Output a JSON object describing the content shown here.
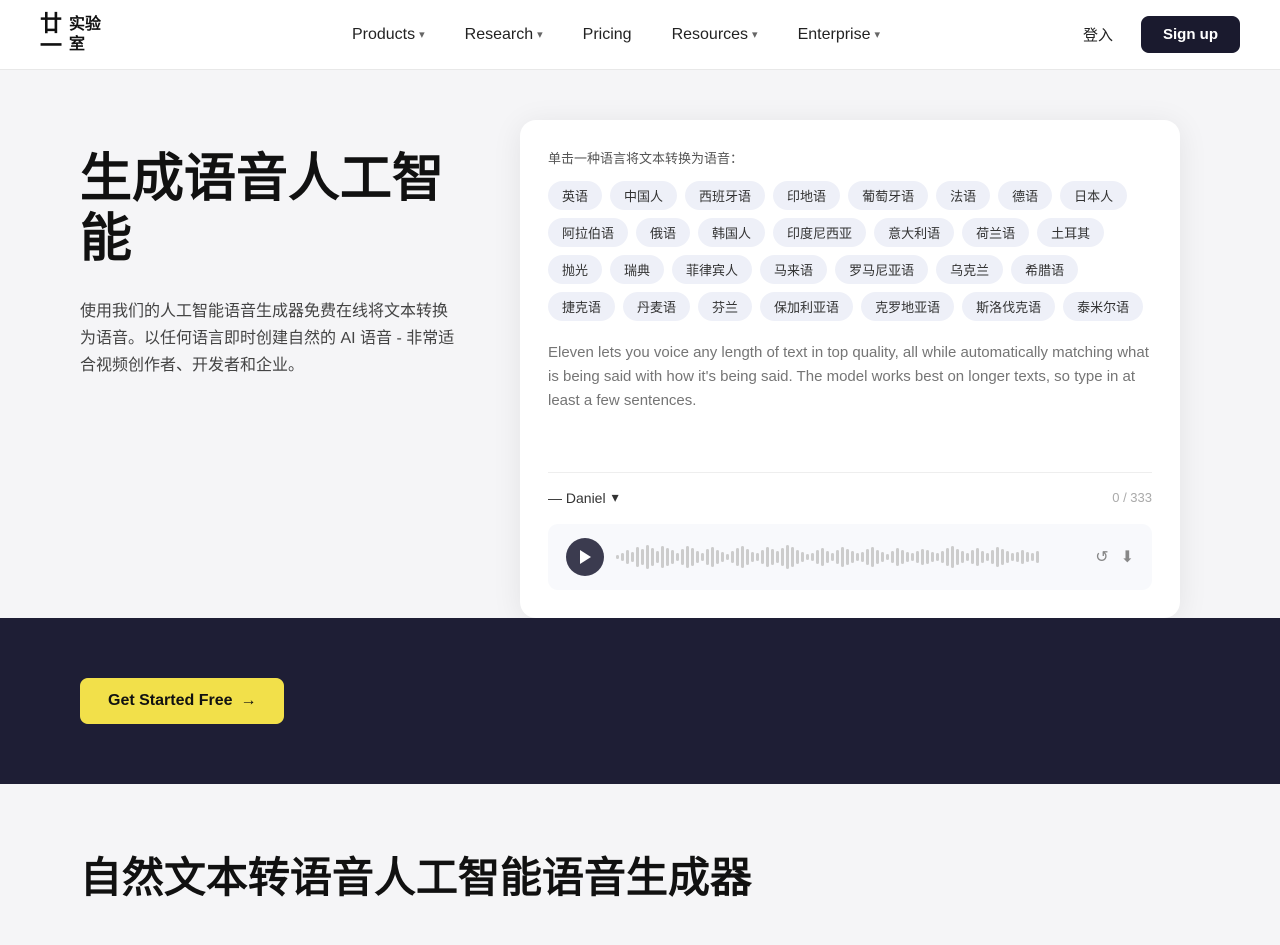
{
  "logo": {
    "icon": "廿一",
    "text_line1": "实验",
    "text_line2": "室"
  },
  "nav": {
    "links": [
      {
        "label": "Products",
        "has_dropdown": true
      },
      {
        "label": "Research",
        "has_dropdown": true
      },
      {
        "label": "Pricing",
        "has_dropdown": false
      },
      {
        "label": "Resources",
        "has_dropdown": true
      },
      {
        "label": "Enterprise",
        "has_dropdown": true
      }
    ],
    "login_label": "登入",
    "signup_label": "Sign up"
  },
  "hero": {
    "title": "生成语音人工智能",
    "description": "使用我们的人工智能语音生成器免费在线将文本转换为语音。以任何语言即时创建自然的 AI 语音 - 非常适合视频创作者、开发者和企业。",
    "lang_label": "单击一种语言将文本转换为语音："
  },
  "languages": [
    "英语",
    "中国人",
    "西班牙语",
    "印地语",
    "葡萄牙语",
    "法语",
    "德语",
    "日本人",
    "阿拉伯语",
    "俄语",
    "韩国人",
    "印度尼西亚",
    "意大利语",
    "荷兰语",
    "土耳其",
    "抛光",
    "瑞典",
    "菲律宾人",
    "马来语",
    "罗马尼亚语",
    "乌克兰",
    "希腊语",
    "捷克语",
    "丹麦语",
    "芬兰",
    "保加利亚语",
    "克罗地亚语",
    "斯洛伐克语",
    "泰米尔语"
  ],
  "textarea": {
    "placeholder": "Eleven lets you voice any length of text in top quality, all while automatically matching what is being said with how it's being said. The model works best on longer texts, so type in at least a few sentences."
  },
  "voice": {
    "label": "— Daniel",
    "char_count": "0 / 333"
  },
  "cta": {
    "button_label": "Get Started Free",
    "arrow": "→"
  },
  "bottom": {
    "title": "自然文本转语音人工智能语音生成器"
  }
}
